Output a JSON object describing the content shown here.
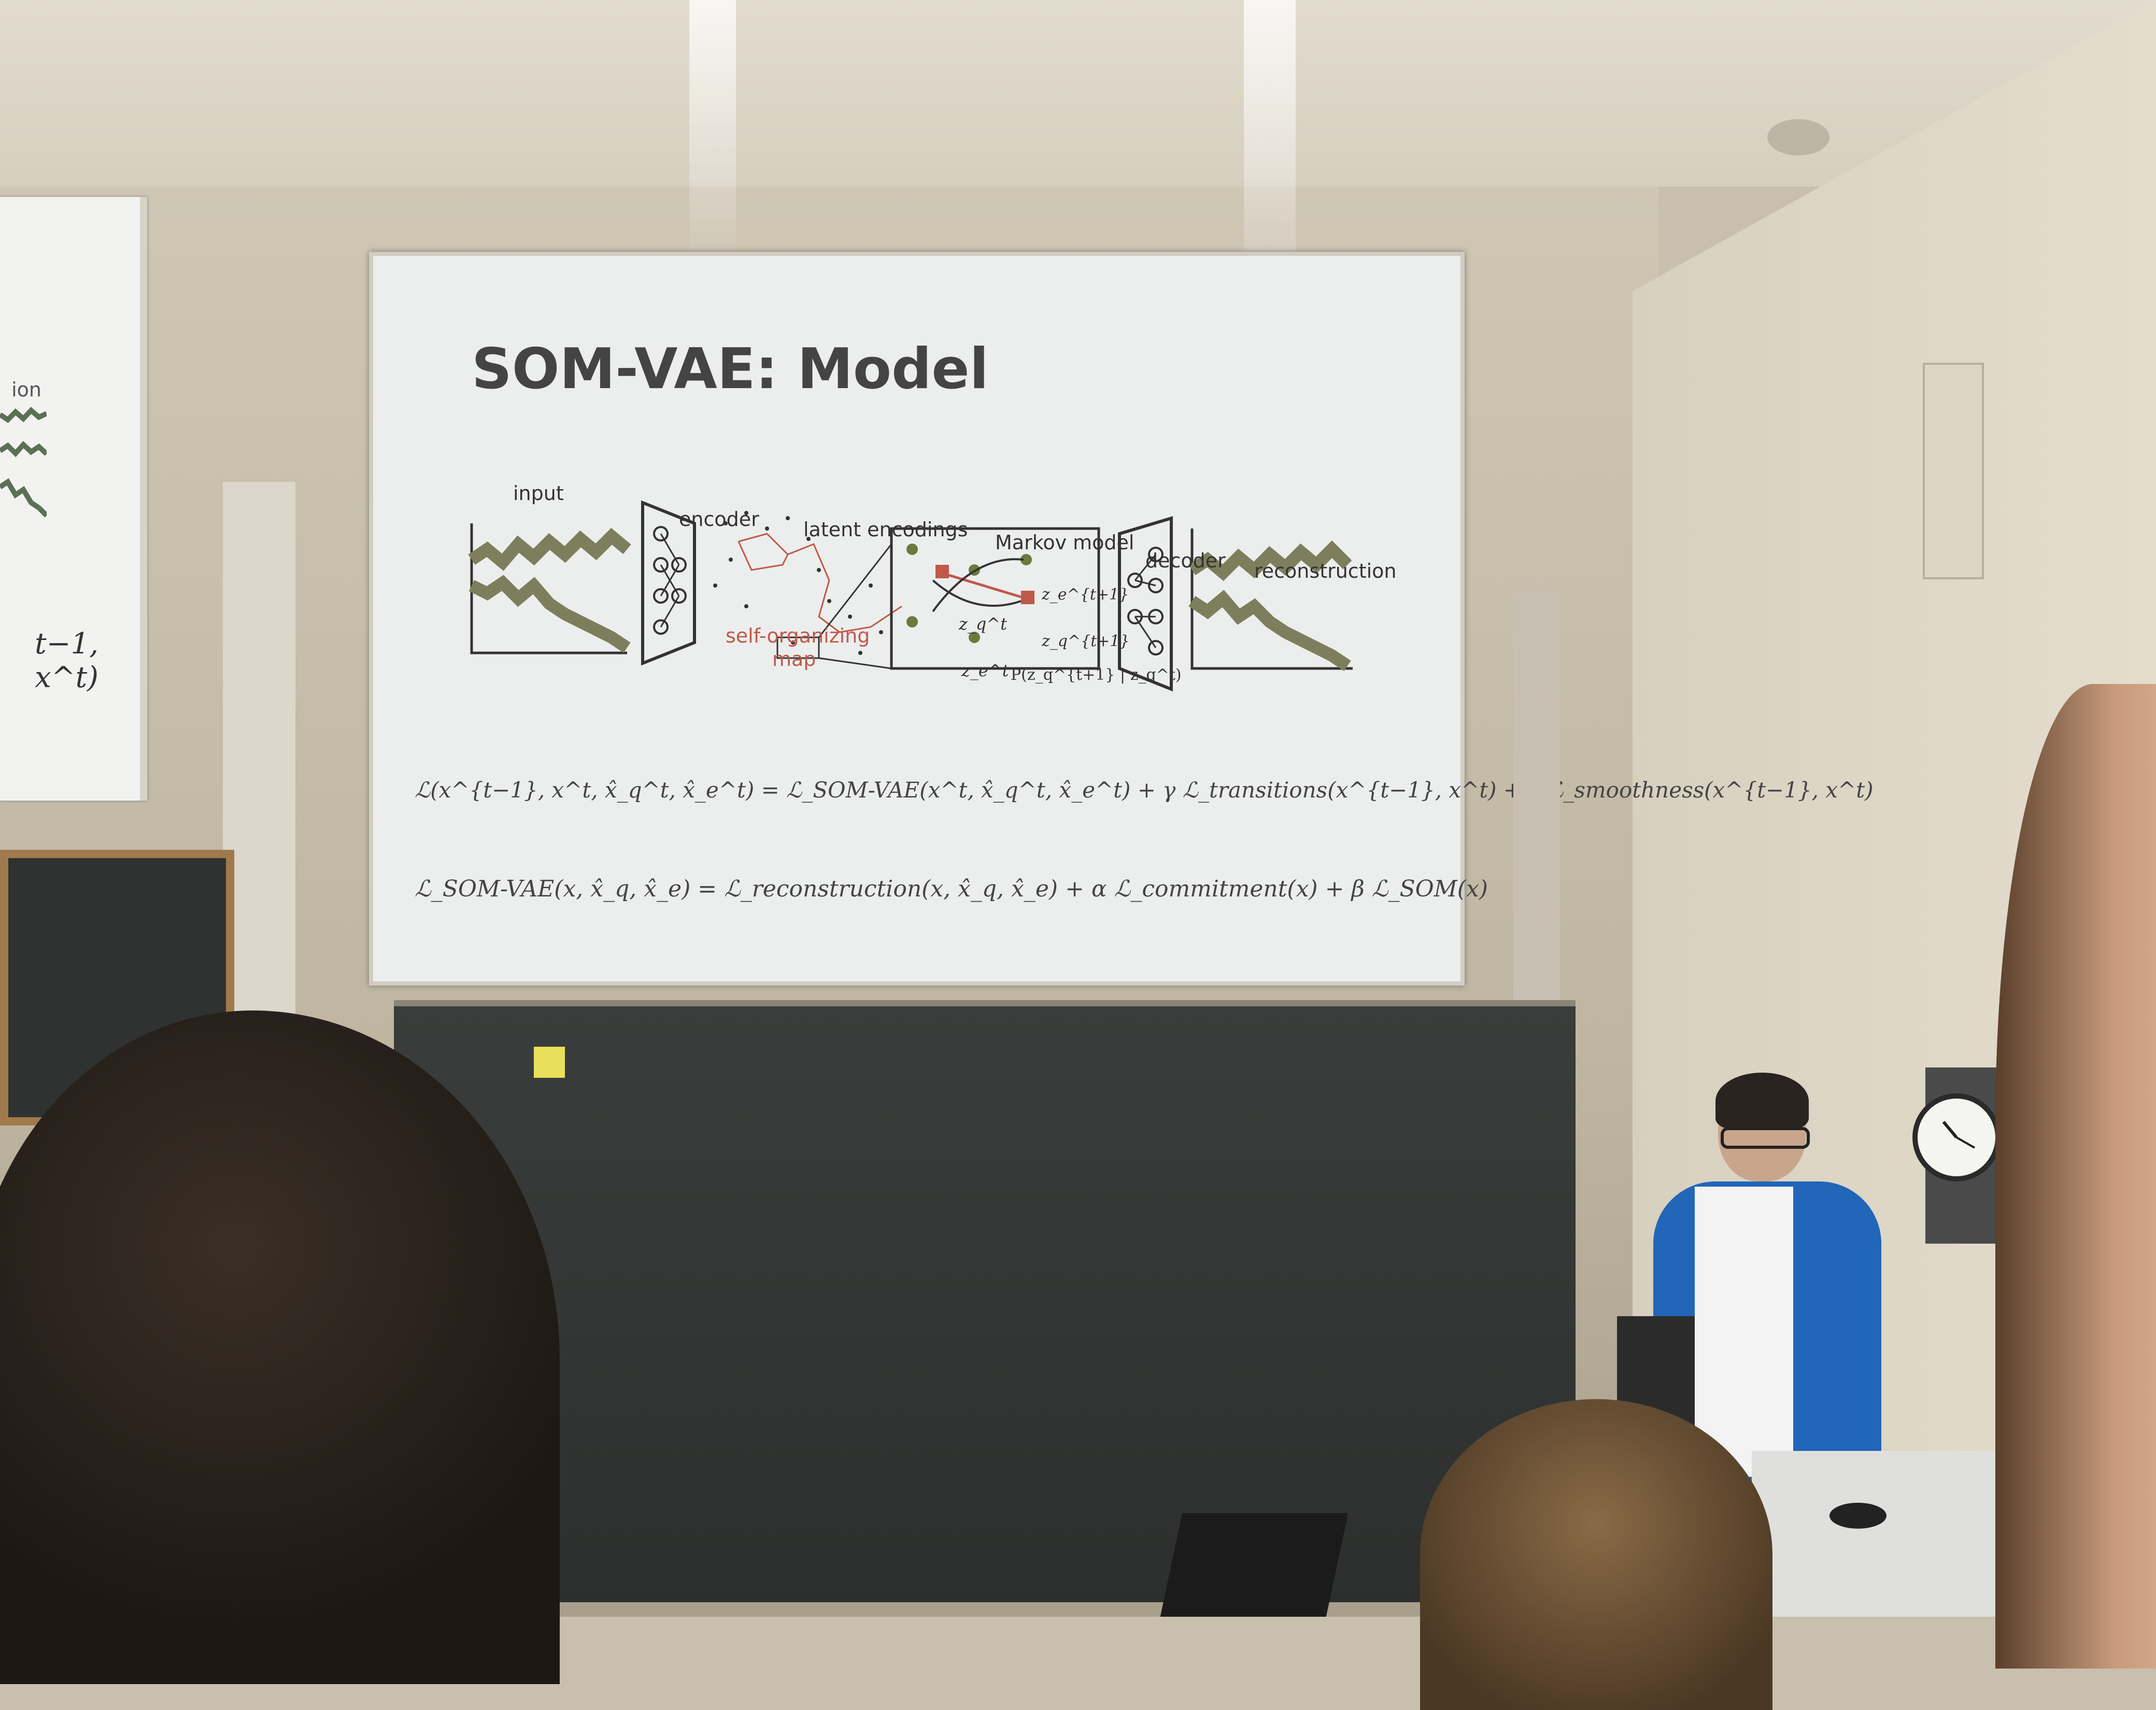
{
  "slide": {
    "title": "SOM-VAE: Model",
    "figure_labels": {
      "input": "input",
      "encoder": "encoder",
      "latent": "latent encodings",
      "markov": "Markov model",
      "decoder": "decoder",
      "reconstruction": "reconstruction",
      "som_line1": "self-organizing",
      "som_line2": "map",
      "z_q_t": "z_q^t",
      "z_e_t1": "z_e^{t+1}",
      "z_q_t1": "z_q^{t+1}",
      "z_e_t": "z_e^t",
      "prob": "P(z_q^{t+1} | z_q^t)"
    },
    "equation1": "ℒ(x^{t−1}, x^t, x̂_q^t, x̂_e^t) = ℒ_SOM-VAE(x^t, x̂_q^t, x̂_e^t) + γ ℒ_transitions(x^{t−1}, x^t) + τ ℒ_smoothness(x^{t−1}, x^t)",
    "equation2": "ℒ_SOM-VAE(x, x̂_q, x̂_e) = ℒ_reconstruction(x, x̂_q, x̂_e) + α ℒ_commitment(x) + β ℒ_SOM(x)"
  },
  "left_screen": {
    "partial_label": "ion",
    "partial_formula": "t−1, x^t)"
  },
  "colors": {
    "slide_bg": "#eceeed",
    "accent_red": "#c0594a",
    "curve_olive": "#7d7f5c",
    "title_text": "#444444"
  }
}
